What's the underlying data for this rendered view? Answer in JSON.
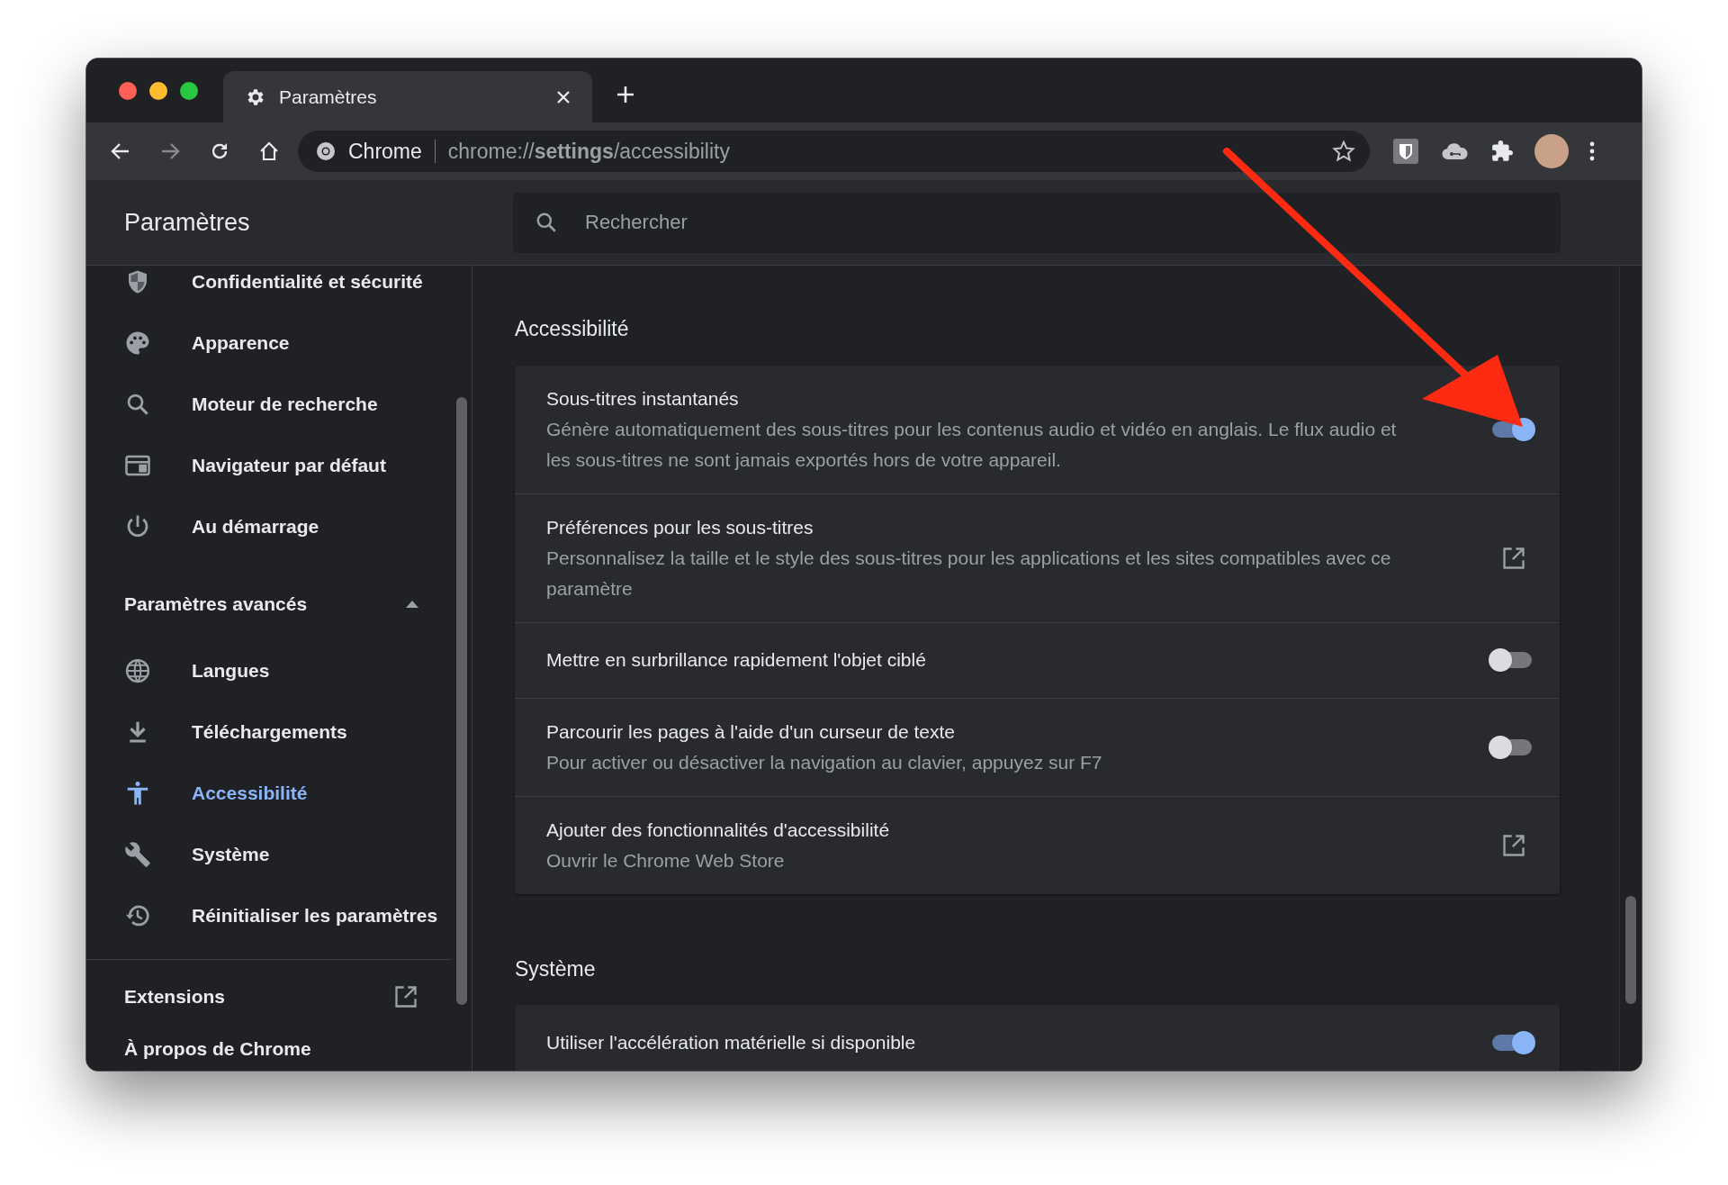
{
  "window": {
    "tabs": [
      {
        "title": "Paramètres",
        "selected": true
      }
    ],
    "address": {
      "site": "Chrome",
      "url": "chrome://**settings**/accessibility"
    }
  },
  "settings_header": {
    "title": "Paramètres",
    "search": {
      "placeholder": "Rechercher"
    }
  },
  "sidebar": {
    "items": [
      {
        "label": "Confidentialité et sécurité",
        "selected": false
      },
      {
        "label": "Apparence",
        "selected": false
      },
      {
        "label": "Moteur de recherche",
        "selected": false
      },
      {
        "label": "Navigateur par défaut",
        "selected": false
      },
      {
        "label": "Au démarrage",
        "selected": false
      }
    ],
    "advanced": {
      "label": "Paramètres avancés",
      "expanded": true,
      "items": [
        {
          "label": "Langues",
          "selected": false
        },
        {
          "label": "Téléchargements",
          "selected": false
        },
        {
          "label": "Accessibilité",
          "selected": true
        },
        {
          "label": "Système",
          "selected": false
        },
        {
          "label": "Réinitialiser les paramètres",
          "selected": false
        }
      ]
    },
    "footer": [
      {
        "label": "Extensions",
        "kind": "external"
      },
      {
        "label": "À propos de Chrome",
        "kind": "plain"
      }
    ]
  },
  "sections": [
    {
      "title": "Accessibilité",
      "rows": [
        {
          "kind": "toggle",
          "title": "Sous-titres instantanés",
          "description": "Génère automatiquement des sous-titres pour les contenus audio et vidéo en anglais. Le flux audio et les sous-titres ne sont jamais exportés hors de votre appareil.",
          "on": true
        },
        {
          "kind": "link",
          "title": "Préférences pour les sous-titres",
          "description": "Personnalisez la taille et le style des sous-titres pour les applications et les sites compatibles avec ce paramètre"
        },
        {
          "kind": "toggle",
          "title": "Mettre en surbrillance rapidement l'objet ciblé",
          "on": false
        },
        {
          "kind": "toggle",
          "title": "Parcourir les pages à l'aide d'un curseur de texte",
          "description": "Pour activer ou désactiver la navigation au clavier, appuyez sur F7",
          "on": false
        },
        {
          "kind": "link",
          "title": "Ajouter des fonctionnalités d'accessibilité",
          "description": "Ouvrir le Chrome Web Store"
        }
      ]
    },
    {
      "title": "Système",
      "rows": [
        {
          "kind": "toggle",
          "title": "Utiliser l'accélération matérielle si disponible",
          "on": true
        }
      ]
    }
  ]
}
